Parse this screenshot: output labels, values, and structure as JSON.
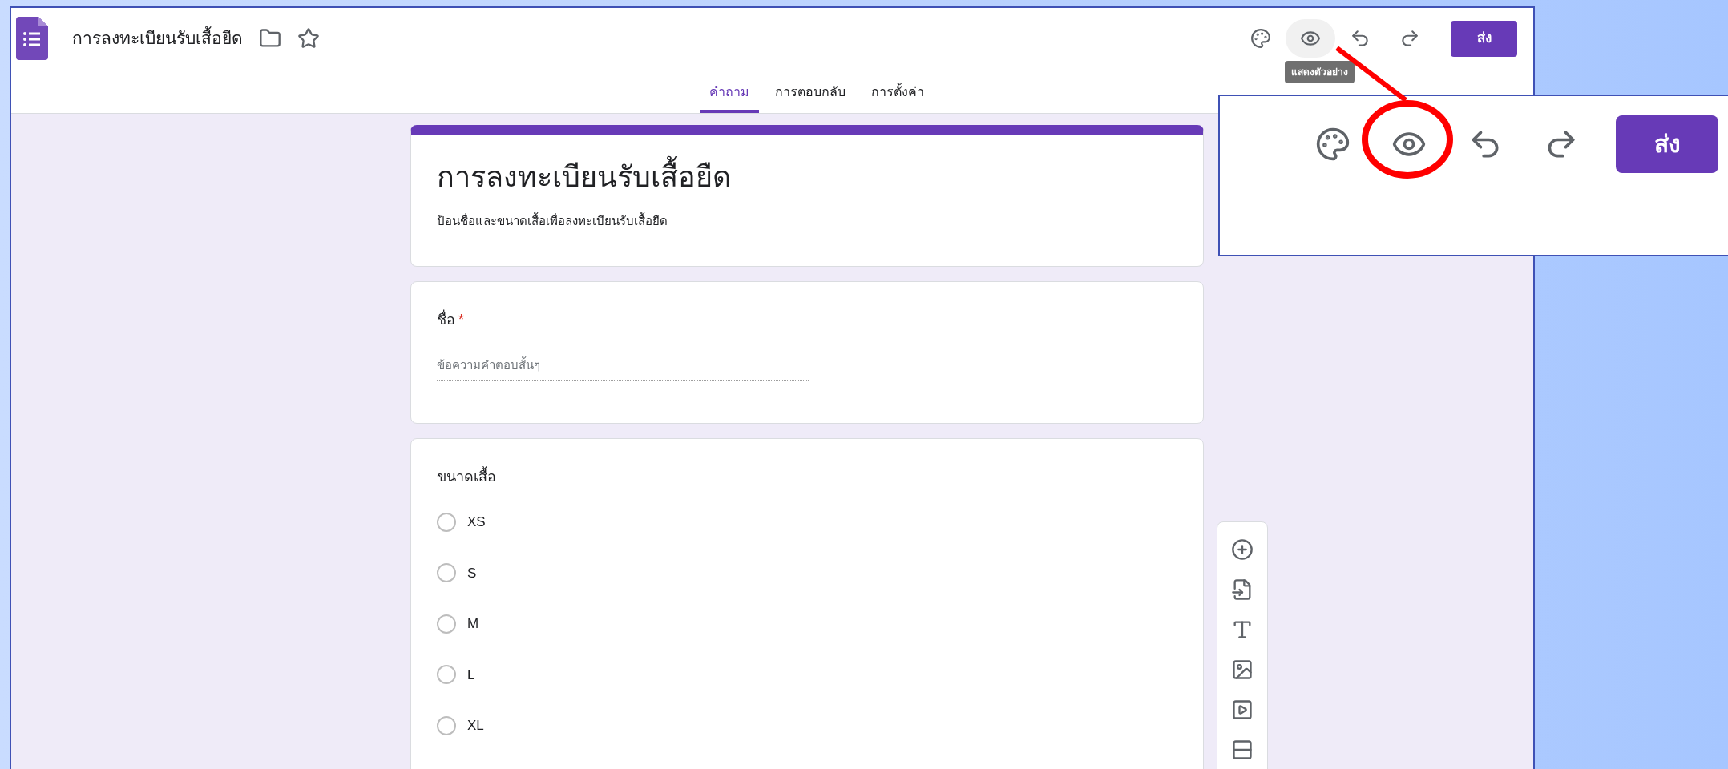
{
  "app": {
    "doc_title": "การลงทะเบียนรับเสื้อยืด"
  },
  "toolbar": {
    "tooltip": "แสดงตัวอย่าง",
    "send_button": "ส่ง"
  },
  "tabs": [
    {
      "label": "คำถาม",
      "selected": true
    },
    {
      "label": "การตอบกลับ",
      "selected": false
    },
    {
      "label": "การตั้งค่า",
      "selected": false
    }
  ],
  "form": {
    "title": "การลงทะเบียนรับเสื้อยืด",
    "description": "ป้อนชื่อและขนาดเสื้อเพื่อลงทะเบียนรับเสื้อยืด",
    "questions": [
      {
        "kind": "short_answer",
        "title": "ชื่อ",
        "required_mark": "*",
        "placeholder": "ข้อความคำตอบสั้นๆ"
      },
      {
        "kind": "multiple_choice",
        "title": "ขนาดเสื้อ",
        "options": [
          {
            "label": "XS",
            "selected": false
          },
          {
            "label": "S",
            "selected": false
          },
          {
            "label": "M",
            "selected": false
          },
          {
            "label": "L",
            "selected": false
          },
          {
            "label": "XL",
            "selected": false
          }
        ]
      }
    ]
  },
  "callout": {
    "send_button": "ส่ง"
  }
}
